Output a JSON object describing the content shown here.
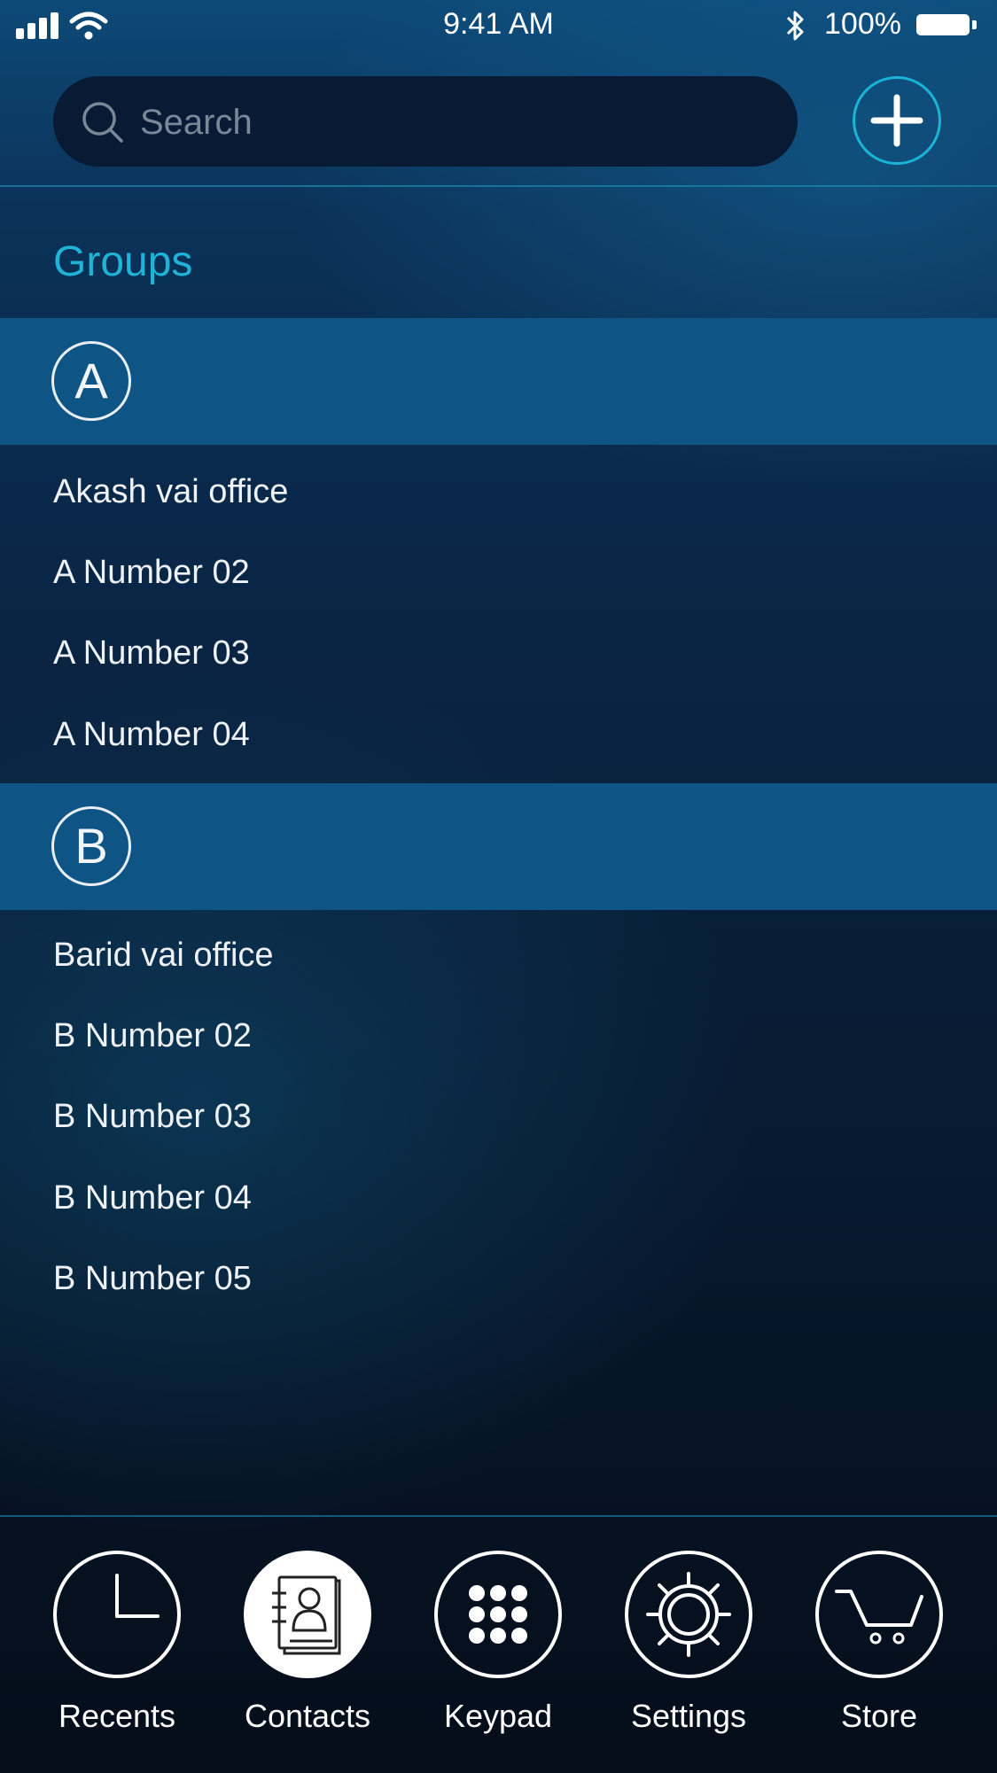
{
  "status_bar": {
    "time": "9:41 AM",
    "battery_percent": "100%",
    "battery_level": 1.0,
    "icons": [
      "signal-icon",
      "wifi-icon",
      "bluetooth-icon",
      "battery-icon"
    ]
  },
  "search": {
    "placeholder": "Search",
    "icon": "search-icon"
  },
  "add_button": {
    "icon": "plus-icon"
  },
  "groups_title": "Groups",
  "sections": [
    {
      "letter": "A",
      "contacts": [
        "Akash vai office",
        "A Number 02",
        "A Number 03",
        "A Number 04"
      ]
    },
    {
      "letter": "B",
      "contacts": [
        "Barid vai office",
        "B Number 02",
        "B Number 03",
        "B Number 04",
        "B Number 05"
      ]
    }
  ],
  "tabs": [
    {
      "label": "Recents",
      "icon": "clock-icon",
      "active": false
    },
    {
      "label": "Contacts",
      "icon": "contact-book-icon",
      "active": true
    },
    {
      "label": "Keypad",
      "icon": "keypad-icon",
      "active": false
    },
    {
      "label": "Settings",
      "icon": "gear-icon",
      "active": false
    },
    {
      "label": "Store",
      "icon": "cart-icon",
      "active": false
    }
  ],
  "colors": {
    "accent": "#1fb3d8",
    "section_header": "#0e5585",
    "search_bg": "#081a34",
    "background_top": "#0d4a78",
    "background_bottom": "#050d19"
  }
}
